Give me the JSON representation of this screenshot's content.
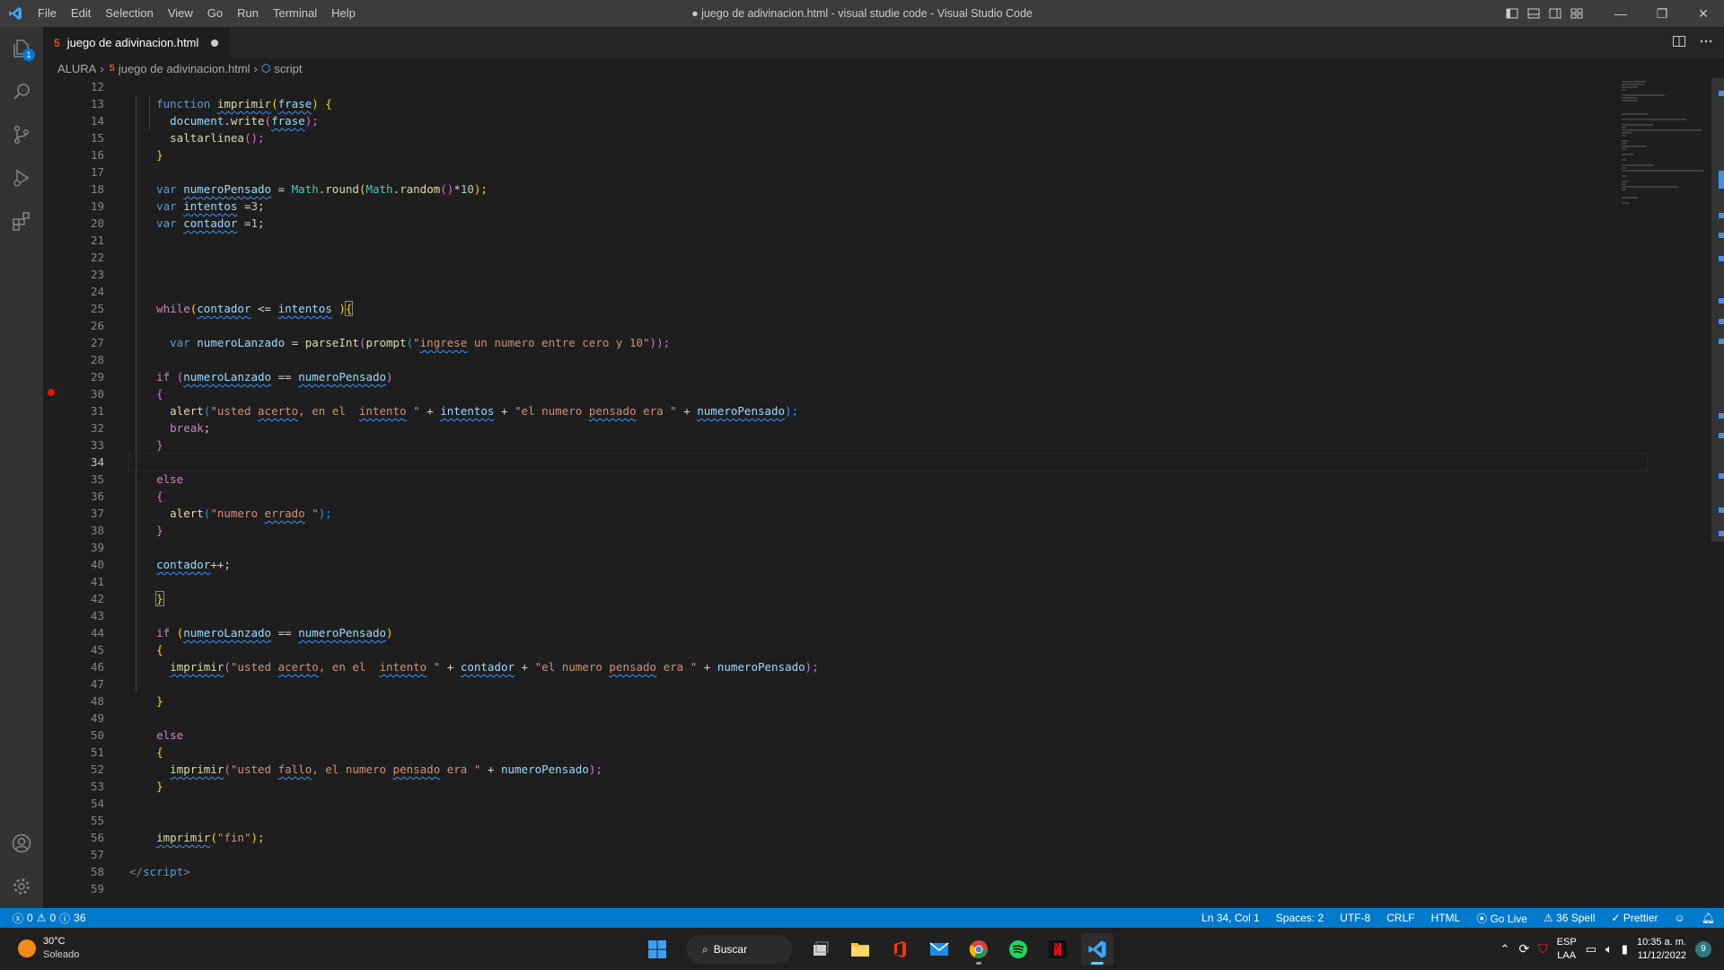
{
  "titlebar": {
    "menu": [
      "File",
      "Edit",
      "Selection",
      "View",
      "Go",
      "Run",
      "Terminal",
      "Help"
    ],
    "window_title": "● juego de adivinacion.html - visual studie code - Visual Studio Code",
    "controls": {
      "minimize": "—",
      "restore": "❐",
      "close": "✕"
    }
  },
  "activitybar": {
    "items": [
      "explorer-icon",
      "search-icon",
      "source-control-icon",
      "run-debug-icon",
      "extensions-icon"
    ],
    "explorer_badge": "1",
    "bottom": [
      "account-icon",
      "gear-icon"
    ]
  },
  "tab": {
    "icon": "5",
    "label": "juego de adivinacion.html"
  },
  "breadcrumb": {
    "root": "ALURA",
    "file": "juego de adivinacion.html",
    "symbol": "script"
  },
  "editor": {
    "language": "HTML",
    "active_line": 34,
    "breakpoint_line": 30,
    "line_numbers": [
      "12",
      "13",
      "14",
      "15",
      "16",
      "17",
      "18",
      "19",
      "20",
      "21",
      "22",
      "23",
      "24",
      "25",
      "26",
      "27",
      "28",
      "29",
      "30",
      "31",
      "32",
      "33",
      "34",
      "35",
      "36",
      "37",
      "38",
      "39",
      "40",
      "41",
      "42",
      "43",
      "44",
      "45",
      "46",
      "47",
      "48",
      "49",
      "50",
      "51",
      "52",
      "53",
      "54",
      "55",
      "56",
      "57",
      "58",
      "59"
    ],
    "code": {
      "l13": {
        "kw": "function",
        "fn": "imprimir",
        "p1": "(",
        "param": "frase",
        "p2": ") {"
      },
      "l14": {
        "obj": "document",
        "dot": ".",
        "fn": "write",
        "p1": "(",
        "arg": "frase",
        "p2": ");"
      },
      "l15": {
        "fn": "saltarlinea",
        "p": "();"
      },
      "l16": {
        "b": "}"
      },
      "l18": {
        "kw": "var",
        "name": "numeroPensado",
        "eq": " = ",
        "cls": "Math",
        "dot": ".",
        "fn": "round",
        "p1": "(",
        "cls2": "Math",
        "dot2": ".",
        "fn2": "random",
        "p2": "()",
        "op": "*",
        "num": "10",
        "p3": ");"
      },
      "l19": {
        "kw": "var",
        "name": "intentos",
        "eq": " =",
        "num": "3",
        "end": ";"
      },
      "l20": {
        "kw": "var",
        "name": "contador",
        "eq": " =",
        "num": "1",
        "end": ";"
      },
      "l25": {
        "ctl": "while",
        "p1": "(",
        "a": "contador",
        "op": " <= ",
        "b": "intentos",
        "sp": " ",
        "p2": ")",
        "br": "{"
      },
      "l27": {
        "kw": "var",
        "name": "numeroLanzado",
        "eq": " = ",
        "fn": "parseInt",
        "p1": "(",
        "fn2": "prompt",
        "p2": "(",
        "s1": "\"",
        "s2": "ingrese",
        "s3": " un numero entre cero y 10\"",
        "p3": "));"
      },
      "l29": {
        "ctl": "if",
        "p1": " (",
        "a": "numeroLanzado",
        "op": " == ",
        "b": "numeroPensado",
        "p2": ")"
      },
      "l30": {
        "b": "{"
      },
      "l31": {
        "fn": "alert",
        "p1": "(",
        "s1": "\"usted ",
        "w1": "acerto",
        "s2": ", en el  ",
        "w2": "intento",
        "s3": " \"",
        "op1": " + ",
        "v1": "intentos",
        "op2": " + ",
        "s4": "\"el numero ",
        "w3": "pensado",
        "s5": " era \"",
        "op3": " + ",
        "v2": "numeroPensado",
        "p2": ");"
      },
      "l32": {
        "ctl": "break",
        "end": ";"
      },
      "l33": {
        "b": "}"
      },
      "l35": {
        "ctl": "else"
      },
      "l36": {
        "b": "{"
      },
      "l37": {
        "fn": "alert",
        "p1": "(",
        "s1": "\"numero ",
        "w1": "errado",
        "s2": " \"",
        "p2": ");"
      },
      "l38": {
        "b": "}"
      },
      "l40": {
        "v": "contador",
        "op": "++",
        "end": ";"
      },
      "l42": {
        "b": "}"
      },
      "l44": {
        "ctl": "if",
        "p1": " (",
        "a": "numeroLanzado",
        "op": " == ",
        "b": "numeroPensado",
        "p2": ")"
      },
      "l45": {
        "b": "{"
      },
      "l46": {
        "fn": "imprimir",
        "p1": "(",
        "s1": "\"usted ",
        "w1": "acerto",
        "s2": ", en el  ",
        "w2": "intento",
        "s3": " \"",
        "op1": " + ",
        "v1": "contador",
        "op2": " + ",
        "s4": "\"el numero ",
        "w3": "pensado",
        "s5": " era \"",
        "op3": " + ",
        "v2": "numeroPensado",
        "p2": ");"
      },
      "l48": {
        "b": "}"
      },
      "l50": {
        "ctl": "else"
      },
      "l51": {
        "b": "{"
      },
      "l52": {
        "fn": "imprimir",
        "p1": "(",
        "s1": "\"usted ",
        "w1": "fallo",
        "s2": ", el numero ",
        "w2": "pensado",
        "s3": " era \"",
        "op": " + ",
        "v": "numeroPensado",
        "p2": ");"
      },
      "l53": {
        "b": "}"
      },
      "l56": {
        "fn": "imprimir",
        "p1": "(",
        "s": "\"fin\"",
        "p2": ");"
      },
      "l58": {
        "open": "</",
        "tag": "script",
        "close": ">"
      }
    }
  },
  "statusbar": {
    "errors": "0",
    "warnings": "0",
    "info": "36",
    "position": "Ln 34, Col 1",
    "spaces": "Spaces: 2",
    "encoding": "UTF-8",
    "eol": "CRLF",
    "language": "HTML",
    "go_live": "Go Live",
    "spell": "36 Spell",
    "prettier": "Prettier"
  },
  "taskbar": {
    "weather_temp": "30°C",
    "weather_desc": "Soleado",
    "search_label": "Buscar",
    "lang_top": "ESP",
    "lang_bottom": "LAA",
    "time": "10:35 a. m.",
    "date": "11/12/2022",
    "notifications": "9"
  },
  "colors": {
    "accent": "#007acc",
    "titlebar": "#3c3c3c",
    "activitybar": "#333333",
    "editor_bg": "#1e1e1e",
    "breakpoint": "#e51400"
  }
}
